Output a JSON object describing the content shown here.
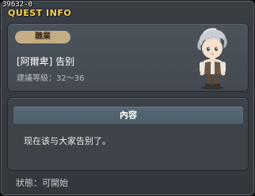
{
  "window": {
    "quest_id": "39632-0",
    "title": "QUEST INFO"
  },
  "info": {
    "job_badge": "職業",
    "quest_name": "[阿爾卑] 告别",
    "level_requirement": "建議等級：32～36"
  },
  "content": {
    "header": "內容",
    "text": "现在该与大家告别了。"
  },
  "footer": {
    "status": "狀態：可開始"
  },
  "colors": {
    "title": "#f5d35a",
    "badge": "#c3ae86",
    "header_bar": "#586876"
  }
}
